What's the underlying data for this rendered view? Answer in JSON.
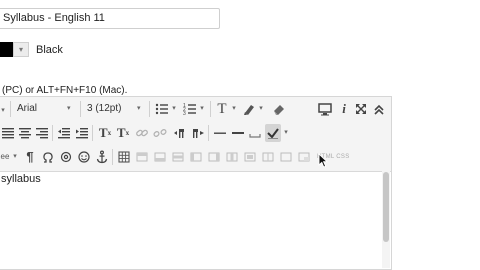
{
  "title_field": {
    "value": "Syllabus - English 11"
  },
  "color_picker": {
    "swatch_color": "#000000",
    "label": "Black"
  },
  "hint_text": "(PC) or ALT+FN+F10 (Mac).",
  "toolbar1": {
    "paragraph_caret": "▾",
    "font_family": "Arial",
    "font_size": "3 (12pt)",
    "text_t": "T"
  },
  "toolbar2": {
    "superscript": "T",
    "subscript": "T"
  },
  "toolbar3": {
    "style_label": "ее",
    "pilcrow": "¶",
    "html_css_label": "HTML CSS"
  },
  "editor": {
    "content_text": "syllabus"
  }
}
